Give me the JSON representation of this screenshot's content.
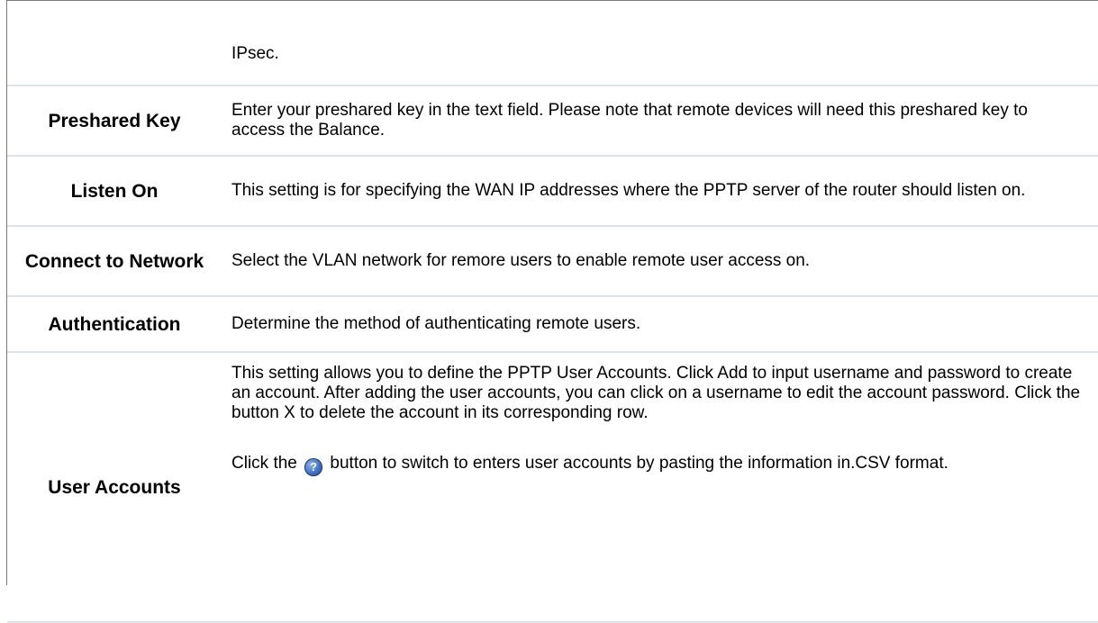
{
  "rows": [
    {
      "label": "",
      "description": "IPsec."
    },
    {
      "label": "Preshared Key",
      "description": "Enter your preshared key in the text field. Please note that remote devices will need this preshared key to access the Balance."
    },
    {
      "label": "Listen On",
      "description": "This setting is for specifying the WAN IP addresses where the PPTP server of the router should listen on."
    },
    {
      "label": "Connect to Network",
      "description": "Select the VLAN network for remore users to enable remote user access on."
    },
    {
      "label": "Authentication",
      "description": "Determine the method of authenticating remote users."
    },
    {
      "label": "User Accounts",
      "description": "This setting allows you to define the PPTP User Accounts. Click Add to input username and password to create an account. After adding the user accounts, you can click on a username to edit the account password. Click the button X to delete the account in its corresponding row.",
      "note_before_icon": "Click the",
      "note_icon": "help-icon",
      "note_after_icon": "button to switch to enters user accounts by pasting the information in.CSV format."
    }
  ]
}
